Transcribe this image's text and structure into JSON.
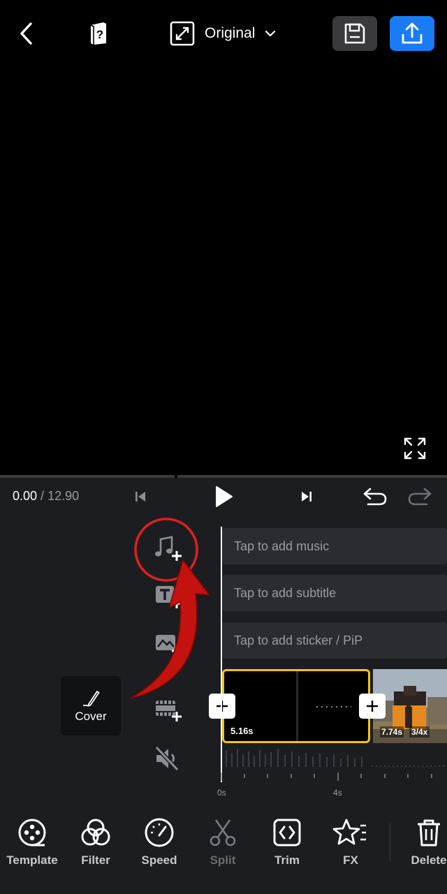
{
  "topbar": {
    "ratio_label": "Original",
    "icons": [
      "back-icon",
      "help-book-icon",
      "aspect-ratio-icon",
      "chevron-down-icon",
      "save-icon",
      "export-icon"
    ]
  },
  "playback": {
    "current_time": "0.00",
    "separator": " / ",
    "total_time": "12.90"
  },
  "tracks": {
    "music": "Tap to add music",
    "subtitle": "Tap to add subtitle",
    "sticker": "Tap to add sticker / PiP"
  },
  "cover": {
    "label": "Cover"
  },
  "clips": [
    {
      "duration": "5.16s"
    },
    {
      "duration": "7.74s",
      "speed": "3/4x"
    }
  ],
  "ruler": {
    "ticks": [
      "0s",
      "4s"
    ]
  },
  "toolbar": {
    "items": [
      {
        "label": "Template",
        "enabled": true
      },
      {
        "label": "Filter",
        "enabled": true
      },
      {
        "label": "Speed",
        "enabled": true
      },
      {
        "label": "Split",
        "enabled": false
      },
      {
        "label": "Trim",
        "enabled": true
      },
      {
        "label": "FX",
        "enabled": true
      },
      {
        "label": "Delete",
        "enabled": true
      }
    ]
  },
  "colors": {
    "accent_blue": "#1a7cf5",
    "clip_selected": "#f2c31a",
    "annotation_red": "#e0201c",
    "panel_bg": "#1c1d21",
    "track_bg": "#2b2c31"
  }
}
